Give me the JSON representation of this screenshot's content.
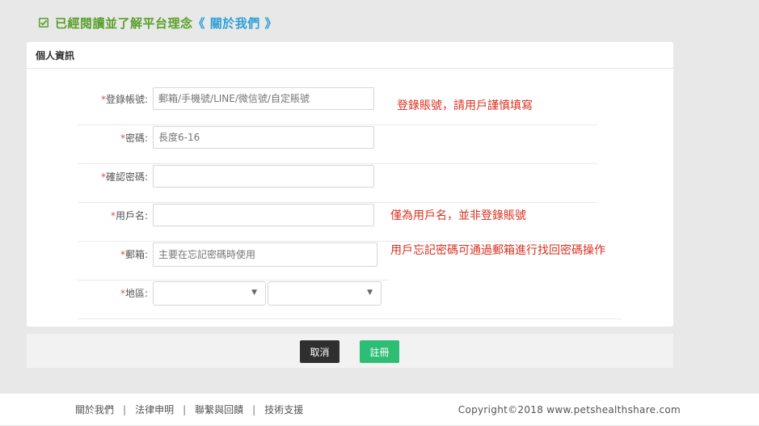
{
  "agreement": {
    "text": "已經閱讀並了解平台理念",
    "link": "《 關於我們 》"
  },
  "panel": {
    "title": "個人資訊"
  },
  "form": {
    "account": {
      "label": "登錄帳號:",
      "placeholder": "郵箱/手機號/LINE/微信號/自定賬號"
    },
    "password": {
      "label": "密碼:",
      "placeholder": "長度6-16"
    },
    "confirm": {
      "label": "確認密碼:",
      "placeholder": ""
    },
    "username": {
      "label": "用戶名:",
      "placeholder": ""
    },
    "email": {
      "label": "郵箱:",
      "placeholder": "主要在忘記密碼時使用"
    },
    "region": {
      "label": "地區:"
    },
    "required_mark": "*"
  },
  "notes": {
    "account": "登錄賬號，請用戶謹慎填寫",
    "username": "僅為用戶名，並非登錄賬號",
    "email": "用戶忘記密碼可通過郵箱進行找回密碼操作"
  },
  "actions": {
    "cancel": "取消",
    "submit": "註冊"
  },
  "footer": {
    "links": [
      "關於我們",
      "法律申明",
      "聯繫與回饋",
      "技術支援"
    ],
    "separator": "|",
    "copyright": "Copyright©2018 www.petshealthshare.com"
  },
  "colors": {
    "green": "#5aa02c",
    "link_blue": "#2f9fd6",
    "note_red": "#d9301f",
    "submit_green": "#2ebd74"
  }
}
